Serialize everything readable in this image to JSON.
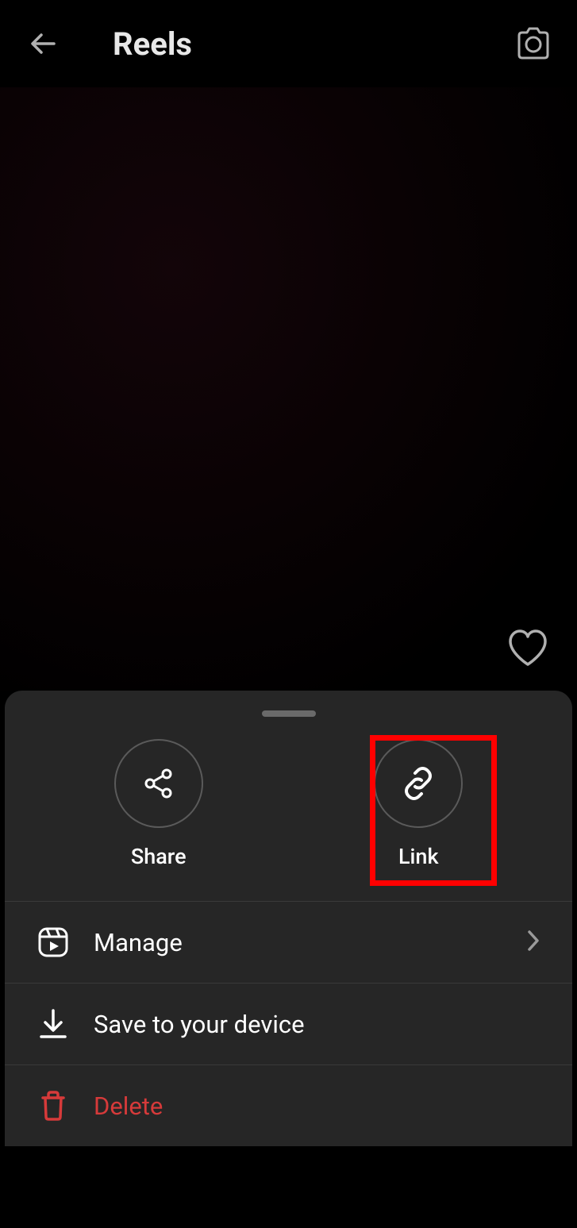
{
  "header": {
    "title": "Reels"
  },
  "actions": {
    "share_label": "Share",
    "link_label": "Link"
  },
  "menu": {
    "manage_label": "Manage",
    "save_label": "Save to your device",
    "delete_label": "Delete"
  },
  "colors": {
    "highlight": "#ff0000",
    "danger": "#d63a3a"
  }
}
